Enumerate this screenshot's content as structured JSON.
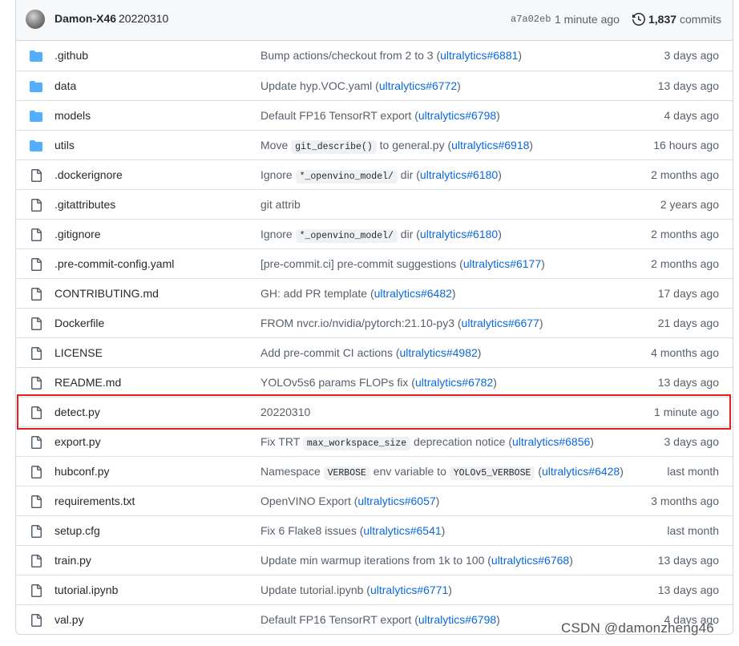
{
  "commit": {
    "author": "Damon-X46",
    "message": "20220310",
    "sha": "a7a02eb",
    "time": "1 minute ago",
    "count": "1,837",
    "count_label": "commits"
  },
  "colors": {
    "folder": "#54aeff",
    "file": "#57606a",
    "link": "#0969da",
    "highlight": "#e4201f"
  },
  "files": [
    {
      "type": "folder",
      "name": ".github",
      "msg": [
        {
          "t": "Bump actions/checkout from 2 to 3 ("
        },
        {
          "link": "ultralytics#6881"
        },
        {
          "t": ")"
        }
      ],
      "age": "3 days ago"
    },
    {
      "type": "folder",
      "name": "data",
      "msg": [
        {
          "t": "Update hyp.VOC.yaml ("
        },
        {
          "link": "ultralytics#6772"
        },
        {
          "t": ")"
        }
      ],
      "age": "13 days ago"
    },
    {
      "type": "folder",
      "name": "models",
      "msg": [
        {
          "t": "Default FP16 TensorRT export ("
        },
        {
          "link": "ultralytics#6798"
        },
        {
          "t": ")"
        }
      ],
      "age": "4 days ago"
    },
    {
      "type": "folder",
      "name": "utils",
      "msg": [
        {
          "t": "Move "
        },
        {
          "code": "git_describe()"
        },
        {
          "t": " to general.py ("
        },
        {
          "link": "ultralytics#6918"
        },
        {
          "t": ")"
        }
      ],
      "age": "16 hours ago"
    },
    {
      "type": "file",
      "name": ".dockerignore",
      "msg": [
        {
          "t": "Ignore "
        },
        {
          "code": "*_openvino_model/"
        },
        {
          "t": " dir ("
        },
        {
          "link": "ultralytics#6180"
        },
        {
          "t": ")"
        }
      ],
      "age": "2 months ago"
    },
    {
      "type": "file",
      "name": ".gitattributes",
      "msg": [
        {
          "t": "git attrib"
        }
      ],
      "age": "2 years ago"
    },
    {
      "type": "file",
      "name": ".gitignore",
      "msg": [
        {
          "t": "Ignore "
        },
        {
          "code": "*_openvino_model/"
        },
        {
          "t": " dir ("
        },
        {
          "link": "ultralytics#6180"
        },
        {
          "t": ")"
        }
      ],
      "age": "2 months ago"
    },
    {
      "type": "file",
      "name": ".pre-commit-config.yaml",
      "msg": [
        {
          "t": "[pre-commit.ci] pre-commit suggestions ("
        },
        {
          "link": "ultralytics#6177"
        },
        {
          "t": ")"
        }
      ],
      "age": "2 months ago"
    },
    {
      "type": "file",
      "name": "CONTRIBUTING.md",
      "msg": [
        {
          "t": "GH: add PR template ("
        },
        {
          "link": "ultralytics#6482"
        },
        {
          "t": ")"
        }
      ],
      "age": "17 days ago"
    },
    {
      "type": "file",
      "name": "Dockerfile",
      "msg": [
        {
          "t": "FROM nvcr.io/nvidia/pytorch:21.10-py3 ("
        },
        {
          "link": "ultralytics#6677"
        },
        {
          "t": ")"
        }
      ],
      "age": "21 days ago"
    },
    {
      "type": "file",
      "name": "LICENSE",
      "msg": [
        {
          "t": "Add pre-commit CI actions ("
        },
        {
          "link": "ultralytics#4982"
        },
        {
          "t": ")"
        }
      ],
      "age": "4 months ago"
    },
    {
      "type": "file",
      "name": "README.md",
      "msg": [
        {
          "t": "YOLOv5s6 params FLOPs fix ("
        },
        {
          "link": "ultralytics#6782"
        },
        {
          "t": ")"
        }
      ],
      "age": "13 days ago"
    },
    {
      "type": "file",
      "name": "detect.py",
      "msg": [
        {
          "t": "20220310"
        }
      ],
      "age": "1 minute ago",
      "highlighted": true
    },
    {
      "type": "file",
      "name": "export.py",
      "msg": [
        {
          "t": "Fix TRT "
        },
        {
          "code": "max_workspace_size"
        },
        {
          "t": " deprecation notice ("
        },
        {
          "link": "ultralytics#6856"
        },
        {
          "t": ")"
        }
      ],
      "age": "3 days ago"
    },
    {
      "type": "file",
      "name": "hubconf.py",
      "msg": [
        {
          "t": "Namespace "
        },
        {
          "code": "VERBOSE"
        },
        {
          "t": " env variable to "
        },
        {
          "code": "YOLOv5_VERBOSE"
        },
        {
          "t": " ("
        },
        {
          "link": "ultralytics#6428"
        },
        {
          "t": ")"
        }
      ],
      "age": "last month"
    },
    {
      "type": "file",
      "name": "requirements.txt",
      "msg": [
        {
          "t": "OpenVINO Export ("
        },
        {
          "link": "ultralytics#6057"
        },
        {
          "t": ")"
        }
      ],
      "age": "3 months ago"
    },
    {
      "type": "file",
      "name": "setup.cfg",
      "msg": [
        {
          "t": "Fix 6 Flake8 issues ("
        },
        {
          "link": "ultralytics#6541"
        },
        {
          "t": ")"
        }
      ],
      "age": "last month"
    },
    {
      "type": "file",
      "name": "train.py",
      "msg": [
        {
          "t": "Update min warmup iterations from 1k to 100 ("
        },
        {
          "link": "ultralytics#6768"
        },
        {
          "t": ")"
        }
      ],
      "age": "13 days ago"
    },
    {
      "type": "file",
      "name": "tutorial.ipynb",
      "msg": [
        {
          "t": "Update tutorial.ipynb ("
        },
        {
          "link": "ultralytics#6771"
        },
        {
          "t": ")"
        }
      ],
      "age": "13 days ago"
    },
    {
      "type": "file",
      "name": "val.py",
      "msg": [
        {
          "t": "Default FP16 TensorRT export ("
        },
        {
          "link": "ultralytics#6798"
        },
        {
          "t": ")"
        }
      ],
      "age": "4 days ago"
    }
  ],
  "watermark": "CSDN @damonzheng46"
}
